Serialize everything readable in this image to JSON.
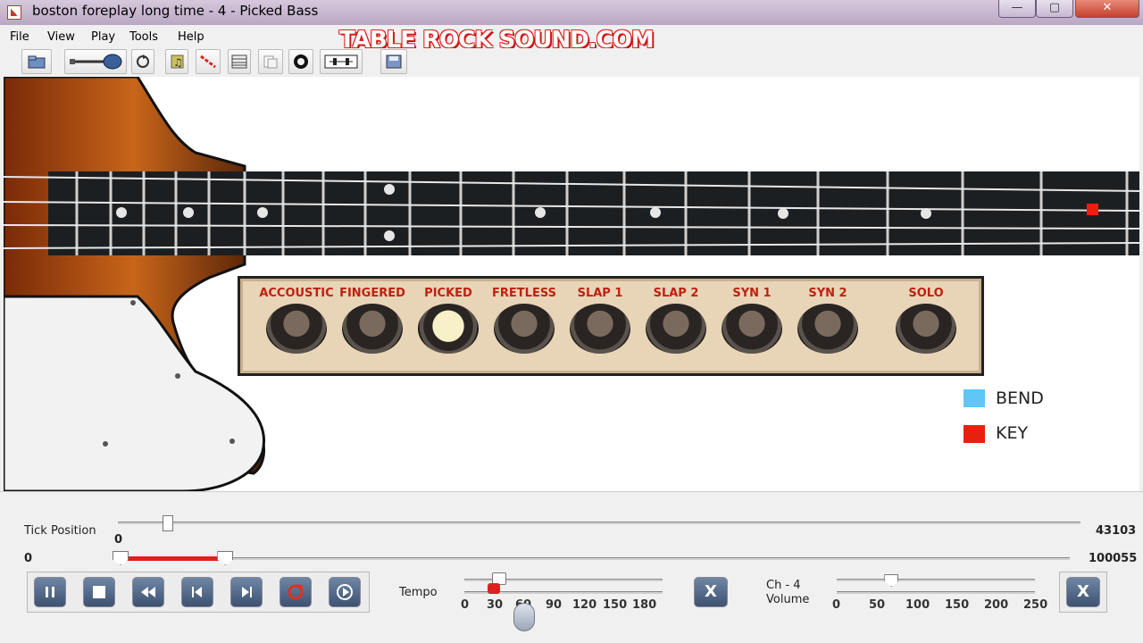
{
  "window": {
    "title": "boston foreplay long time - 4 - Picked Bass",
    "controls": [
      "—",
      "▢",
      "✕"
    ]
  },
  "menu": [
    "File",
    "View",
    "Play",
    "Tools",
    "Help"
  ],
  "logo_text": "TABLE ROCK SOUND.COM",
  "toolbar": {
    "icons": [
      "open-folder-icon",
      "guitar-icon",
      "loop-icon",
      "music-note-icon",
      "red-line-icon",
      "grid-icon",
      "copy-icon",
      "record-icon",
      "mixer-icon",
      "save-icon"
    ]
  },
  "tones": {
    "labels": [
      "ACCOUSTIC",
      "FINGERED",
      "PICKED",
      "FRETLESS",
      "SLAP 1",
      "SLAP 2",
      "SYN 1",
      "SYN 2",
      "SOLO"
    ],
    "selected": "PICKED"
  },
  "legend": {
    "bend_label": "BEND",
    "bend_color": "#5fc6f5",
    "key_label": "KEY",
    "key_color": "#e8210e"
  },
  "tick_position": {
    "label": "Tick Position",
    "value": "0",
    "max": "43103",
    "fraction": 0.005
  },
  "range": {
    "min": "0",
    "max": "100055",
    "start_fraction": 0.0,
    "end_fraction": 0.11
  },
  "tempo": {
    "label": "Tempo",
    "ticks": [
      "0",
      "30",
      "60",
      "90",
      "120",
      "150",
      "180"
    ],
    "value_fraction": 0.14
  },
  "volume": {
    "channel": "Ch - 4",
    "label": "Volume",
    "ticks": [
      "0",
      "50",
      "100",
      "150",
      "200",
      "250"
    ],
    "value_fraction": 0.24
  },
  "player_buttons": [
    "pause-icon",
    "stop-icon",
    "rewind-icon",
    "previous-icon",
    "next-icon",
    "loop-reset-icon",
    "play-record-icon"
  ],
  "close_glyph": "X"
}
